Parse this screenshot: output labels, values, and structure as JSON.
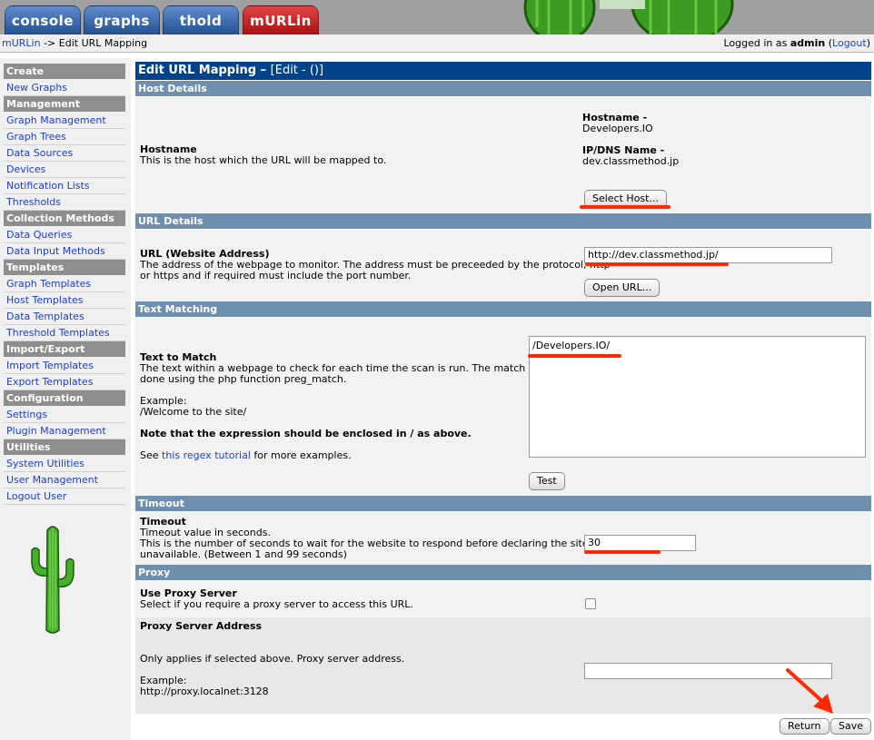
{
  "tabs": [
    {
      "label": "console"
    },
    {
      "label": "graphs"
    },
    {
      "label": "thold"
    },
    {
      "label": "mURLin"
    }
  ],
  "breadcrumb": {
    "root": "mURLin",
    "sep": " -> ",
    "current": "Edit URL Mapping"
  },
  "user": {
    "prefix": "Logged in as ",
    "name": "admin",
    "open": " (",
    "logout": "Logout",
    "close": ")"
  },
  "sidebar": {
    "sections": [
      {
        "title": "Create",
        "items": [
          "New Graphs"
        ]
      },
      {
        "title": "Management",
        "items": [
          "Graph Management",
          "Graph Trees",
          "Data Sources",
          "Devices",
          "Notification Lists",
          "Thresholds"
        ]
      },
      {
        "title": "Collection Methods",
        "items": [
          "Data Queries",
          "Data Input Methods"
        ]
      },
      {
        "title": "Templates",
        "items": [
          "Graph Templates",
          "Host Templates",
          "Data Templates",
          "Threshold Templates"
        ]
      },
      {
        "title": "Import/Export",
        "items": [
          "Import Templates",
          "Export Templates"
        ]
      },
      {
        "title": "Configuration",
        "items": [
          "Settings",
          "Plugin Management"
        ]
      },
      {
        "title": "Utilities",
        "items": [
          "System Utilities",
          "User Management",
          "Logout User"
        ]
      }
    ]
  },
  "form": {
    "title": "Edit URL Mapping –",
    "title_suffix": "[Edit - ()]",
    "host": {
      "section": "Host Details",
      "label": "Hostname",
      "desc": "This is the host which the URL will be mapped to.",
      "hostname_label": "Hostname -",
      "hostname_value": "Developers.IO",
      "ip_label": "IP/DNS Name -",
      "ip_value": "dev.classmethod.jp",
      "button": "Select Host..."
    },
    "url": {
      "section": "URL Details",
      "label": "URL (Website Address)",
      "desc1": "The address of the webpage to monitor. The address must be preceeded by the protocol, http",
      "desc2": "or https and if required must include the port number.",
      "value": "http://dev.classmethod.jp/",
      "button": "Open URL..."
    },
    "text": {
      "section": "Text Matching",
      "label": "Text to Match",
      "desc1": "The text within a webpage to check for each time the scan is run. The match is",
      "desc2": "done using the php function preg_match.",
      "example_label": "Example:",
      "example_value": "/Welcome to the site/",
      "note": "Note that the expression should be enclosed in / as above.",
      "see_pre": "See ",
      "see_link": "this regex tutorial",
      "see_post": " for more examples.",
      "value": "/Developers.IO/",
      "button": "Test"
    },
    "timeout": {
      "section": "Timeout",
      "label": "Timeout",
      "desc1": "Timeout value in seconds.",
      "desc2": "This is the number of seconds to wait for the website to respond before declaring the site is",
      "desc3": "unavailable. (Between 1 and 99 seconds)",
      "value": "30"
    },
    "proxy": {
      "section": "Proxy",
      "use_label": "Use Proxy Server",
      "use_desc": "Select if you require a proxy server to access this URL.",
      "use_checked": false,
      "addr_label": "Proxy Server Address",
      "addr_desc": "Only applies if selected above. Proxy server address.",
      "example_label": "Example:",
      "example_value": "http://proxy.localnet:3128",
      "value": ""
    },
    "buttons": {
      "return": "Return",
      "save": "Save"
    }
  },
  "colors": {
    "annotation": "#ff2a00",
    "header": "#00438b",
    "section": "#6e8fae",
    "menu_head": "#8e8e8e"
  }
}
